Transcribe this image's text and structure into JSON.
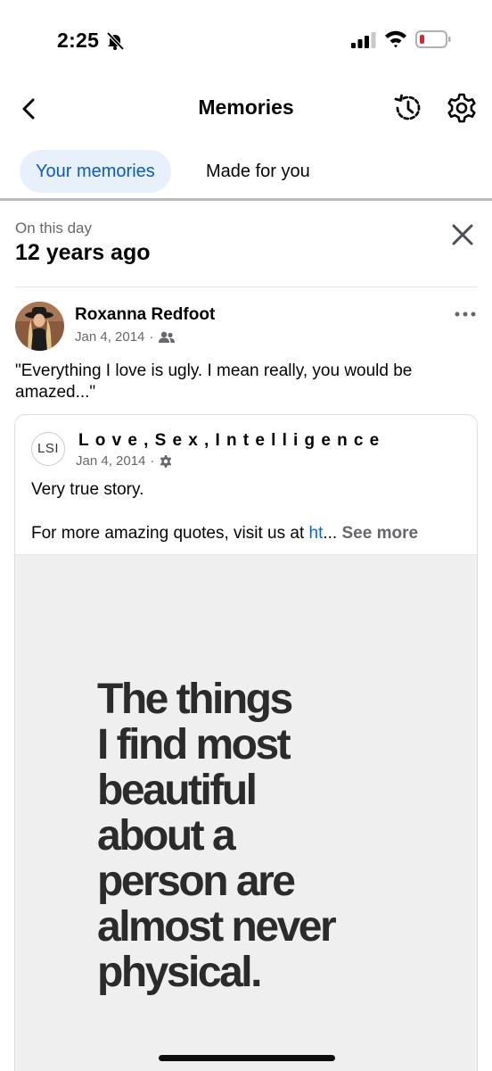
{
  "status_bar": {
    "time": "2:25",
    "icons": [
      "bell-slash-icon",
      "cellular-signal-icon",
      "wifi-icon",
      "battery-low-icon"
    ]
  },
  "header": {
    "title": "Memories",
    "back_icon": "chevron-left-icon",
    "history_icon": "history-clock-icon",
    "settings_icon": "gear-icon"
  },
  "tabs": [
    {
      "label": "Your memories",
      "active": true
    },
    {
      "label": "Made for you",
      "active": false
    }
  ],
  "on_this_day": {
    "label": "On this day",
    "years_ago": "12 years ago",
    "close_icon": "close-icon"
  },
  "post": {
    "author": "Roxanna Redfoot",
    "date": "Jan 4, 2014",
    "separator": "·",
    "audience_icon": "friends-icon",
    "text": "\"Everything I love is ugly.  I mean really, you would be amazed...\"",
    "more_icon": "more-horizontal-icon",
    "shared": {
      "page_logo": "LSI",
      "page_name": "Love,Sex,Intelligence",
      "date": "Jan 4, 2014",
      "separator": "·",
      "audience_icon": "gear-icon",
      "line1": "Very true story.",
      "line2_prefix": "For more amazing quotes, visit us at ",
      "line2_link": "ht",
      "ellipsis": "...",
      "see_more": "See more",
      "image_quote": [
        "The things",
        "I find most",
        "beautiful",
        "about a",
        "person are",
        "almost never",
        "physical."
      ]
    }
  },
  "colors": {
    "accent": "#0a5bc4",
    "tab_active_bg": "#e7f0fb",
    "secondary_text": "#65676b",
    "link": "#0a66d8",
    "battery_low": "#e0242b"
  }
}
